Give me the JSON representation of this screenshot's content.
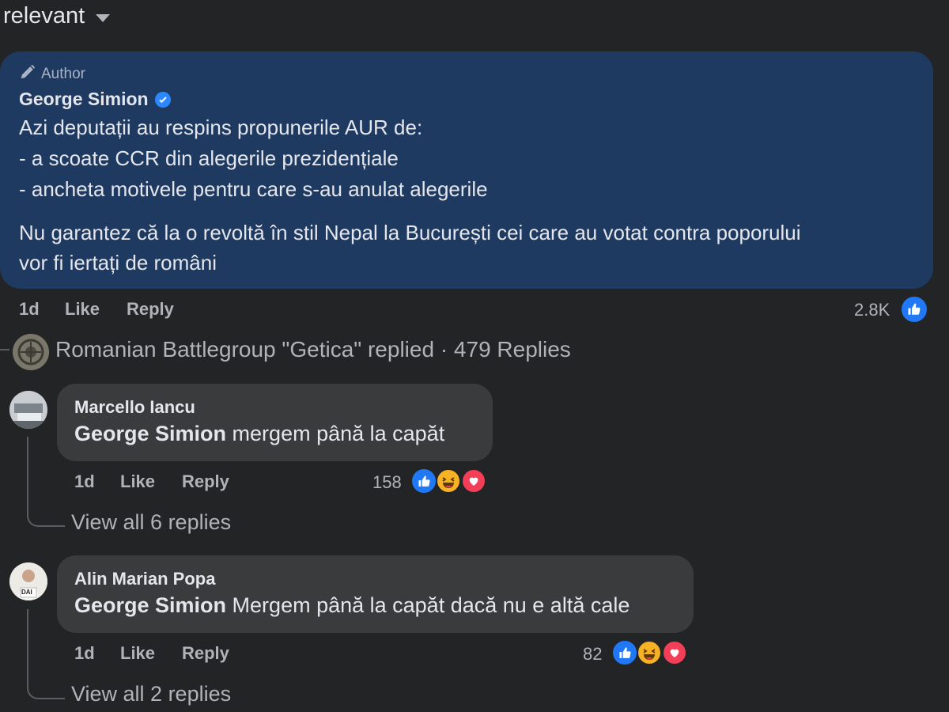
{
  "sort": {
    "label": "relevant"
  },
  "author_comment": {
    "tag": "Author",
    "name": "George Simion",
    "lines": [
      "Azi deputații au respins propunerile AUR de:",
      "- a scoate CCR din alegerile prezidențiale",
      "- ancheta motivele pentru care s-au anulat alegerile",
      "Nu garantez că la o revoltă în stil Nepal la București cei care au votat contra poporului",
      "vor fi iertați de români"
    ],
    "time": "1d",
    "like_label": "Like",
    "reply_label": "Reply",
    "reaction_count": "2.8K"
  },
  "reply_summary": {
    "text": "Romanian Battlegroup \"Getica\" replied · 479 Replies"
  },
  "replies": [
    {
      "name": "Marcello Iancu",
      "mention": "George Simion",
      "text": " mergem până la capăt",
      "time": "1d",
      "like_label": "Like",
      "reply_label": "Reply",
      "reaction_count": "158",
      "view_all": "View all 6 replies"
    },
    {
      "name": "Alin Marian Popa",
      "mention": "George Simion",
      "text": " Mergem până la capăt dacă nu e altă cale",
      "time": "1d",
      "like_label": "Like",
      "reply_label": "Reply",
      "reaction_count": "82",
      "view_all": "View all 2 replies",
      "avatar_text": "DAI"
    }
  ],
  "colors": {
    "background": "#232425",
    "author_bubble": "#1f3a61",
    "comment_bubble": "#3a3b3c",
    "like": "#2078f4",
    "haha": "#f7b125",
    "love": "#f33e58",
    "verified": "#2d88ff"
  },
  "icons": [
    "caret-down-icon",
    "pencil-icon",
    "verified-badge-icon",
    "like-reaction-icon",
    "haha-reaction-icon",
    "love-reaction-icon"
  ]
}
